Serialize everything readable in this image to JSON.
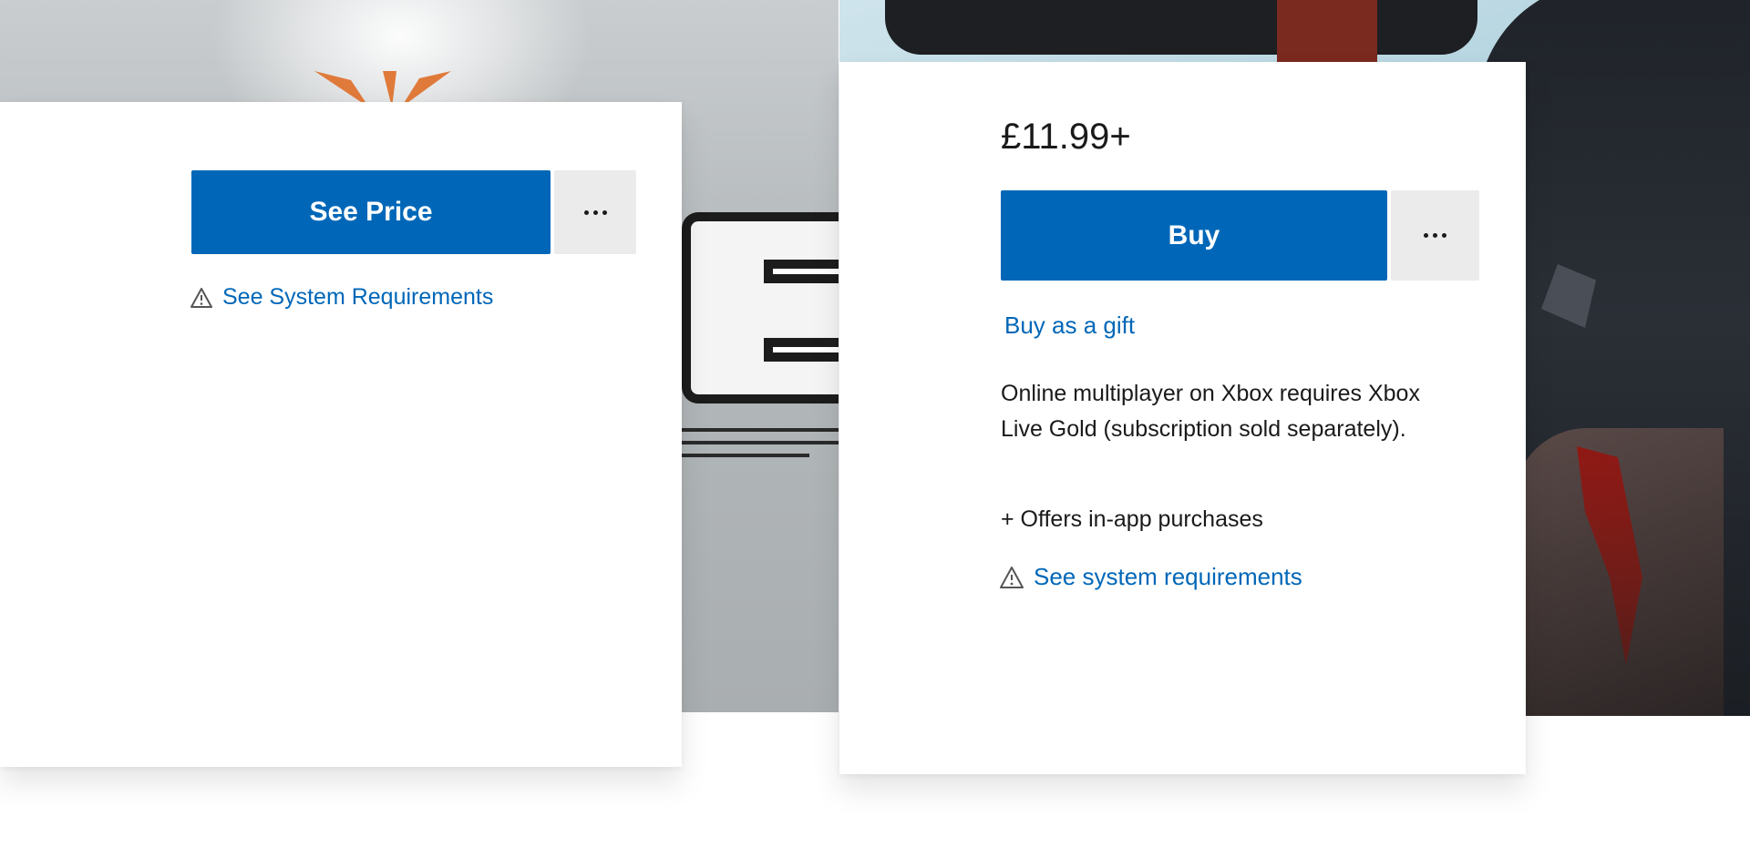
{
  "left_card": {
    "see_price_label": "See Price",
    "system_requirements_link": "See System Requirements"
  },
  "right_card": {
    "price": "£11.99+",
    "buy_label": "Buy",
    "gift_link": "Buy as a gift",
    "multiplayer_note": "Online multiplayer on Xbox requires Xbox Live Gold (subscription sold separately).",
    "in_app_note": "+ Offers in-app purchases",
    "system_requirements_link": "See system requirements"
  },
  "icons": {
    "more": "more-options-icon",
    "warning": "warning-triangle-icon"
  },
  "colors": {
    "accent": "#0067b8",
    "more_button_bg": "#ebebeb",
    "card_bg": "#ffffff"
  }
}
